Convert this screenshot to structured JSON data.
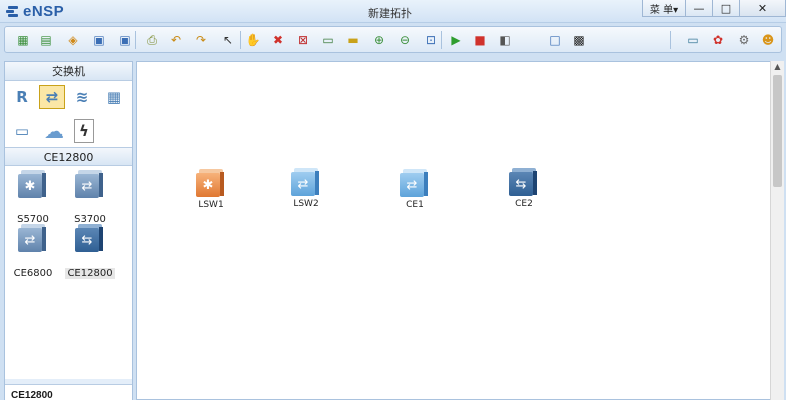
{
  "app": {
    "name": "eNSP",
    "window_title": "新建拓扑"
  },
  "window_controls": {
    "menu_label": "菜 单▾",
    "minimize": "—",
    "maximize": "□",
    "close": "✕"
  },
  "toolbar": {
    "buttons": [
      {
        "name": "new-topology-icon",
        "glyph": "▦",
        "color": "#3a8f3a"
      },
      {
        "name": "new-lab-icon",
        "glyph": "▤",
        "color": "#3a8f3a"
      },
      {
        "name": "open-icon",
        "glyph": "◈",
        "color": "#d08a1a"
      },
      {
        "name": "save-icon",
        "glyph": "▣",
        "color": "#3b6eb5"
      },
      {
        "name": "save-as-icon",
        "glyph": "▣",
        "color": "#3b6eb5"
      },
      {
        "name": "print-icon",
        "glyph": "⎙",
        "color": "#7a8a2a"
      },
      {
        "name": "undo-icon",
        "glyph": "↶",
        "color": "#c98a14"
      },
      {
        "name": "redo-icon",
        "glyph": "↷",
        "color": "#c98a14"
      },
      {
        "name": "select-icon",
        "glyph": "↖",
        "color": "#333333"
      },
      {
        "name": "hand-icon",
        "glyph": "✋",
        "color": "#b07a3a"
      },
      {
        "name": "delete-icon",
        "glyph": "✖",
        "color": "#d0322c"
      },
      {
        "name": "delete-all-icon",
        "glyph": "⊠",
        "color": "#c03030"
      },
      {
        "name": "text-icon",
        "glyph": "▭",
        "color": "#3a7a3a"
      },
      {
        "name": "palette-icon",
        "glyph": "▬",
        "color": "#c9a21a"
      },
      {
        "name": "zoom-in-icon",
        "glyph": "⊕",
        "color": "#3a8f3a"
      },
      {
        "name": "zoom-out-icon",
        "glyph": "⊖",
        "color": "#3a8f3a"
      },
      {
        "name": "fit-icon",
        "glyph": "⊡",
        "color": "#3b6eb5"
      },
      {
        "name": "start-icon",
        "glyph": "▶",
        "color": "#2f9e2f"
      },
      {
        "name": "stop-icon",
        "glyph": "■",
        "color": "#d0322c"
      },
      {
        "name": "capture-icon",
        "glyph": "◧",
        "color": "#555555"
      },
      {
        "name": "grid-icon",
        "glyph": "□",
        "color": "#3b6eb5"
      },
      {
        "name": "topology-icon",
        "glyph": "▩",
        "color": "#222222"
      },
      {
        "name": "chat-icon",
        "glyph": "▭",
        "color": "#3a7a9a"
      },
      {
        "name": "huawei-icon",
        "glyph": "✿",
        "color": "#d0322c"
      },
      {
        "name": "settings-icon",
        "glyph": "⚙",
        "color": "#666666"
      },
      {
        "name": "help-icon",
        "glyph": "☻",
        "color": "#d9951a"
      }
    ]
  },
  "left_panel": {
    "category_title": "交换机",
    "categories": [
      {
        "name": "router-category-icon",
        "glyph": "R",
        "color": "#4a7fb5"
      },
      {
        "name": "switch-category-icon",
        "glyph": "⇄",
        "color": "#4a7fb5"
      },
      {
        "name": "wlan-category-icon",
        "glyph": "≋",
        "color": "#4a7fb5"
      },
      {
        "name": "firewall-category-icon",
        "glyph": "▦",
        "color": "#4a7fb5"
      },
      {
        "name": "pc-category-icon",
        "glyph": "▭",
        "color": "#4a7fb5"
      },
      {
        "name": "cloud-category-icon",
        "glyph": "☁",
        "color": "#6a9ccf"
      },
      {
        "name": "link-category-icon",
        "glyph": "ϟ",
        "color": "#333333"
      }
    ],
    "device_title": "CE12800",
    "devices": [
      {
        "label": "S5700",
        "style": "ic-steel",
        "glyph": "✱"
      },
      {
        "label": "S3700",
        "style": "ic-steel",
        "glyph": "⇄"
      },
      {
        "label": "CE6800",
        "style": "ic-steel",
        "glyph": "⇄"
      },
      {
        "label": "CE12800",
        "style": "ic-dark",
        "glyph": "⇆"
      }
    ],
    "bottom_label": "CE12800"
  },
  "canvas": {
    "nodes": [
      {
        "label": "LSW1",
        "style": "ic-orange",
        "glyph": "✱"
      },
      {
        "label": "LSW2",
        "style": "ic-blue",
        "glyph": "⇄"
      },
      {
        "label": "CE1",
        "style": "ic-blue",
        "glyph": "⇄"
      },
      {
        "label": "CE2",
        "style": "ic-dark",
        "glyph": "⇆"
      }
    ]
  }
}
